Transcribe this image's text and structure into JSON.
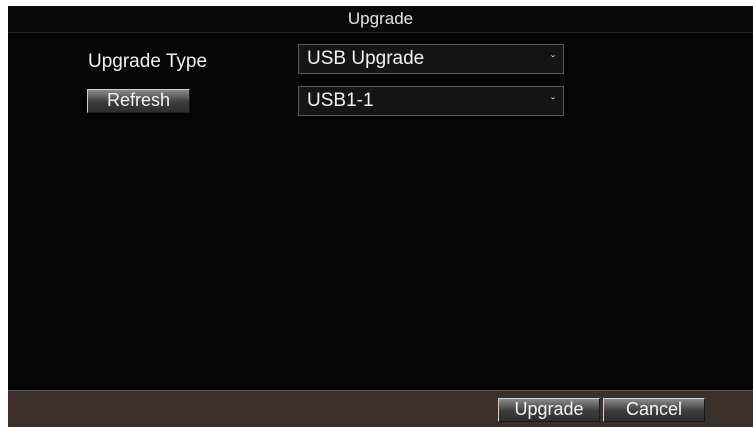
{
  "dialog": {
    "title": "Upgrade"
  },
  "form": {
    "upgrade_type_label": "Upgrade Type",
    "upgrade_type_value": "USB Upgrade",
    "refresh_label": "Refresh",
    "device_value": "USB1-1"
  },
  "footer": {
    "upgrade_label": "Upgrade",
    "cancel_label": "Cancel"
  },
  "icons": {
    "dropdown": "chevron-down-icon"
  }
}
